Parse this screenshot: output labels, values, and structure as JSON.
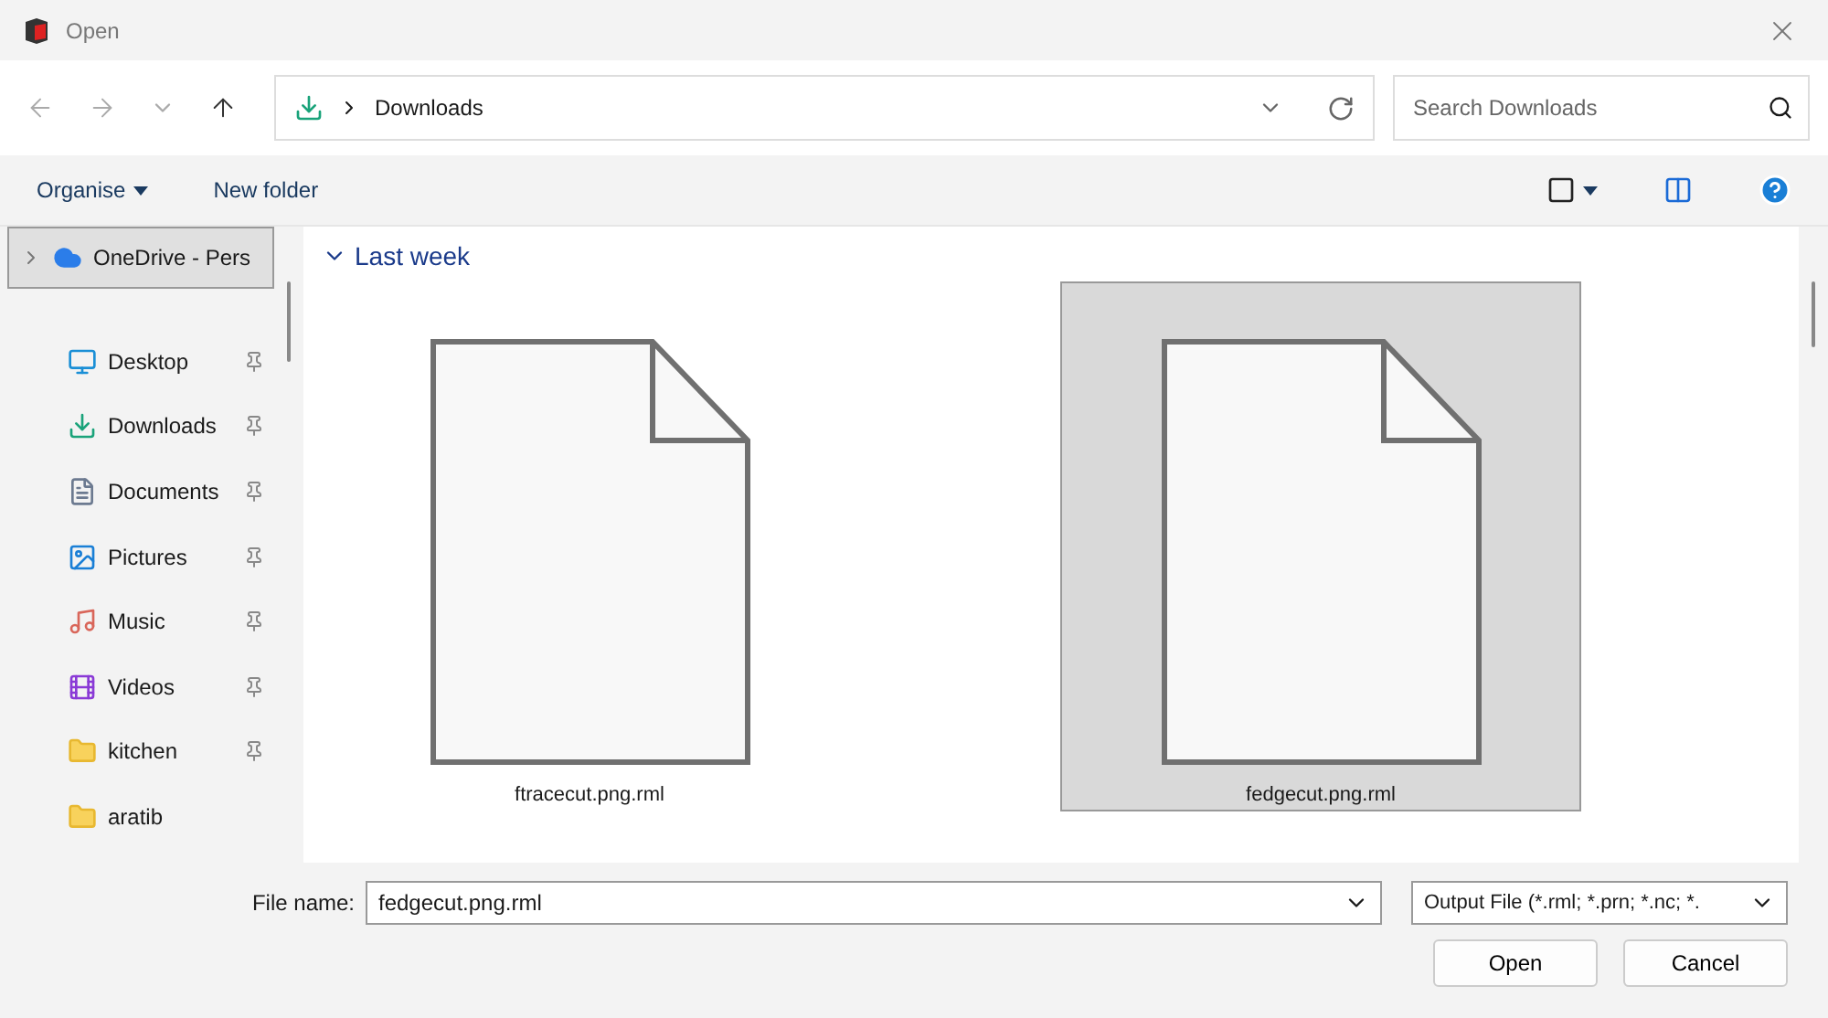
{
  "window": {
    "title": "Open"
  },
  "address": {
    "path": "Downloads"
  },
  "search": {
    "placeholder": "Search Downloads"
  },
  "commands": {
    "organise": "Organise",
    "new_folder": "New folder"
  },
  "sidebar": {
    "items": [
      {
        "label": "OneDrive - Pers",
        "kind": "cloud",
        "selected": true,
        "pinned": false
      },
      {
        "label": "Desktop",
        "kind": "desktop",
        "selected": false,
        "pinned": true
      },
      {
        "label": "Downloads",
        "kind": "downloads",
        "selected": false,
        "pinned": true
      },
      {
        "label": "Documents",
        "kind": "documents",
        "selected": false,
        "pinned": true
      },
      {
        "label": "Pictures",
        "kind": "pictures",
        "selected": false,
        "pinned": true
      },
      {
        "label": "Music",
        "kind": "music",
        "selected": false,
        "pinned": true
      },
      {
        "label": "Videos",
        "kind": "videos",
        "selected": false,
        "pinned": true
      },
      {
        "label": "kitchen",
        "kind": "folder",
        "selected": false,
        "pinned": true
      },
      {
        "label": "aratib",
        "kind": "folder",
        "selected": false,
        "pinned": false
      }
    ]
  },
  "group": {
    "title": "Last week",
    "expanded": true
  },
  "files": [
    {
      "name": "ftracecut.png.rml",
      "selected": false
    },
    {
      "name": "fedgecut.png.rml",
      "selected": true
    }
  ],
  "footer": {
    "file_name_label": "File name:",
    "file_name": "fedgecut.png.rml",
    "file_type": "Output File (*.rml; *.prn; *.nc; *.",
    "buttons": [
      "Open",
      "Cancel"
    ]
  }
}
